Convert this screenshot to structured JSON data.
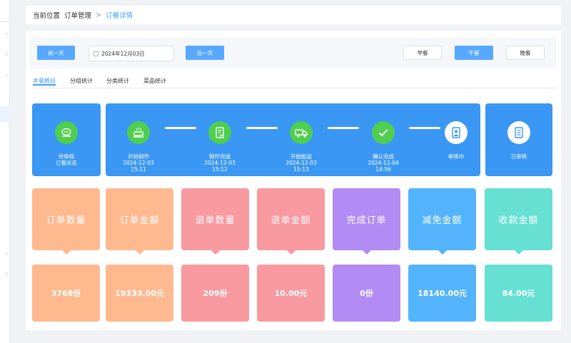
{
  "breadcrumb": {
    "label": "当前位置",
    "parent": "订单管理",
    "separator": ">",
    "current": "订餐详情"
  },
  "toolbar": {
    "prev_day": "前一天",
    "date_value": "2024年12月03日",
    "next_day": "后一天",
    "meals": [
      "早餐",
      "午餐",
      "晚餐"
    ],
    "selected_meal": "午餐"
  },
  "tabs": [
    "本餐概括",
    "分组统计",
    "分类统计",
    "菜品统计"
  ],
  "status": {
    "pending": {
      "line1": "待审核",
      "line2": "订餐状态"
    },
    "stages": [
      {
        "name": "开始制作",
        "date": "2024-12-03",
        "time": "15:11",
        "icon": "cooking-pot-icon"
      },
      {
        "name": "制作完成",
        "date": "2024-12-03",
        "time": "15:12",
        "icon": "document-check-icon"
      },
      {
        "name": "开始配送",
        "date": "2024-12-03",
        "time": "15:13",
        "icon": "delivery-truck-icon"
      },
      {
        "name": "确认完成",
        "date": "2024-12-04",
        "time": "14:56",
        "icon": "checkmark-icon"
      },
      {
        "name": "审核中",
        "icon": "reviewer-icon"
      }
    ],
    "approved": {
      "label": "已审核",
      "icon": "approved-document-icon"
    }
  },
  "stats": [
    {
      "label": "订单数量",
      "value": "3768份",
      "color": "#ffb98f"
    },
    {
      "label": "订单金额",
      "value": "19333.00元",
      "color": "#ffb98f"
    },
    {
      "label": "退单数量",
      "value": "209份",
      "color": "#f89aa0"
    },
    {
      "label": "退单金额",
      "value": "10.00元",
      "color": "#f89aa0"
    },
    {
      "label": "完成订单",
      "value": "0份",
      "color": "#b28cf4"
    },
    {
      "label": "减免金额",
      "value": "18140.00元",
      "color": "#54b4fb"
    },
    {
      "label": "收款金额",
      "value": "84.00元",
      "color": "#66e0d3"
    }
  ],
  "colors": {
    "accent": "#409eff",
    "status_blue": "#3a97f4",
    "stage_green": "#4fce4f"
  }
}
